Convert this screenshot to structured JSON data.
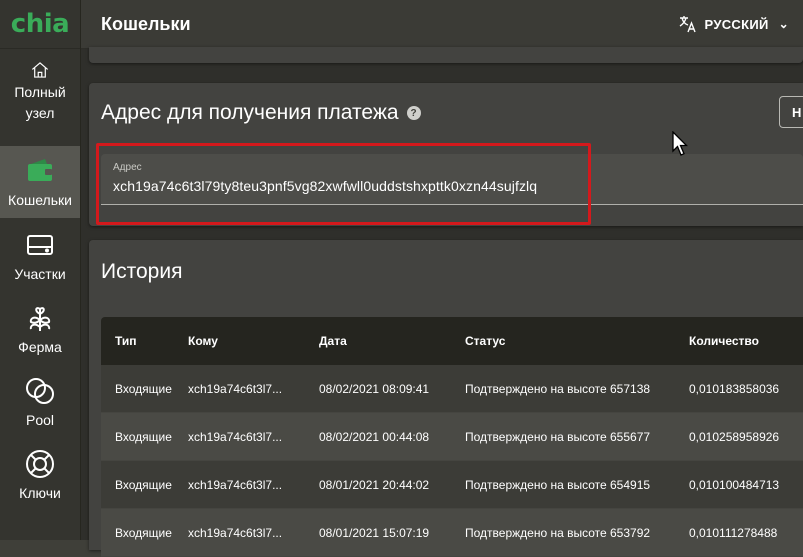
{
  "app": {
    "logo": "chia"
  },
  "sidebar": {
    "items": [
      {
        "label": "Полный узел",
        "icon": "home-icon",
        "active": false
      },
      {
        "label": "Кошельки",
        "icon": "wallet-icon",
        "active": true
      },
      {
        "label": "Участки",
        "icon": "hard-drive-icon",
        "active": false
      },
      {
        "label": "Ферма",
        "icon": "plant-icon",
        "active": false
      },
      {
        "label": "Pool",
        "icon": "pool-circles-icon",
        "active": false
      },
      {
        "label": "Ключи",
        "icon": "lifebuoy-icon",
        "active": false
      }
    ]
  },
  "topbar": {
    "title": "Кошельки",
    "language": "РУССКИЙ"
  },
  "receive": {
    "title": "Адрес для получения платежа",
    "new_button": "Н",
    "field_label": "Адрес",
    "address": "xch19a74c6t3l79ty8teu3pnf5vg82xwfwll0uddstshxpttk0xzn44sujfzlq"
  },
  "history": {
    "title": "История",
    "columns": [
      "Тип",
      "Кому",
      "Дата",
      "Статус",
      "Количество"
    ],
    "rows": [
      [
        "Входящие",
        "xch19a74c6t3l7...",
        "08/02/2021 08:09:41",
        "Подтверждено на высоте 657138",
        "0,010183858036"
      ],
      [
        "Входящие",
        "xch19a74c6t3l7...",
        "08/02/2021 00:44:08",
        "Подтверждено на высоте 655677",
        "0,010258958926"
      ],
      [
        "Входящие",
        "xch19a74c6t3l7...",
        "08/01/2021 20:44:02",
        "Подтверждено на высоте 654915",
        "0,010100484713"
      ],
      [
        "Входящие",
        "xch19a74c6t3l7...",
        "08/01/2021 15:07:19",
        "Подтверждено на высоте 653792",
        "0,010111278488"
      ]
    ]
  },
  "colors": {
    "brand": "#3aac59",
    "highlight": "#d4191c",
    "sidebar_active": "#575751"
  }
}
